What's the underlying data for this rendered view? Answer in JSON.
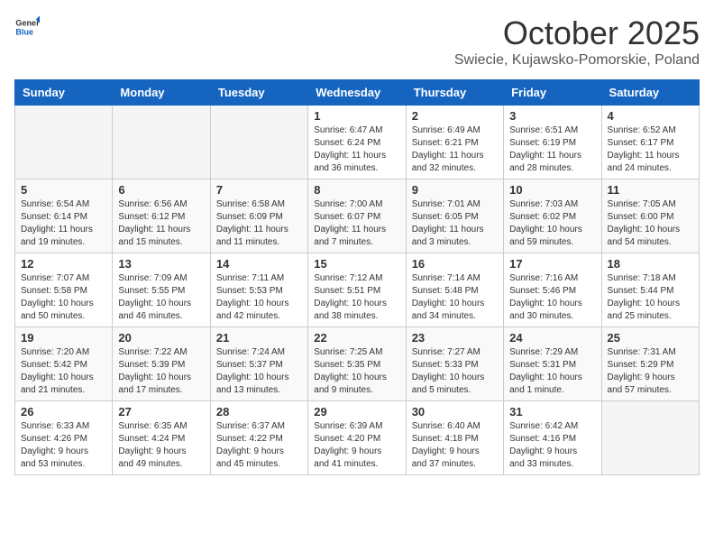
{
  "logo": {
    "general": "General",
    "blue": "Blue"
  },
  "title": "October 2025",
  "subtitle": "Swiecie, Kujawsko-Pomorskie, Poland",
  "days_of_week": [
    "Sunday",
    "Monday",
    "Tuesday",
    "Wednesday",
    "Thursday",
    "Friday",
    "Saturday"
  ],
  "weeks": [
    [
      {
        "day": "",
        "detail": ""
      },
      {
        "day": "",
        "detail": ""
      },
      {
        "day": "",
        "detail": ""
      },
      {
        "day": "1",
        "detail": "Sunrise: 6:47 AM\nSunset: 6:24 PM\nDaylight: 11 hours\nand 36 minutes."
      },
      {
        "day": "2",
        "detail": "Sunrise: 6:49 AM\nSunset: 6:21 PM\nDaylight: 11 hours\nand 32 minutes."
      },
      {
        "day": "3",
        "detail": "Sunrise: 6:51 AM\nSunset: 6:19 PM\nDaylight: 11 hours\nand 28 minutes."
      },
      {
        "day": "4",
        "detail": "Sunrise: 6:52 AM\nSunset: 6:17 PM\nDaylight: 11 hours\nand 24 minutes."
      }
    ],
    [
      {
        "day": "5",
        "detail": "Sunrise: 6:54 AM\nSunset: 6:14 PM\nDaylight: 11 hours\nand 19 minutes."
      },
      {
        "day": "6",
        "detail": "Sunrise: 6:56 AM\nSunset: 6:12 PM\nDaylight: 11 hours\nand 15 minutes."
      },
      {
        "day": "7",
        "detail": "Sunrise: 6:58 AM\nSunset: 6:09 PM\nDaylight: 11 hours\nand 11 minutes."
      },
      {
        "day": "8",
        "detail": "Sunrise: 7:00 AM\nSunset: 6:07 PM\nDaylight: 11 hours\nand 7 minutes."
      },
      {
        "day": "9",
        "detail": "Sunrise: 7:01 AM\nSunset: 6:05 PM\nDaylight: 11 hours\nand 3 minutes."
      },
      {
        "day": "10",
        "detail": "Sunrise: 7:03 AM\nSunset: 6:02 PM\nDaylight: 10 hours\nand 59 minutes."
      },
      {
        "day": "11",
        "detail": "Sunrise: 7:05 AM\nSunset: 6:00 PM\nDaylight: 10 hours\nand 54 minutes."
      }
    ],
    [
      {
        "day": "12",
        "detail": "Sunrise: 7:07 AM\nSunset: 5:58 PM\nDaylight: 10 hours\nand 50 minutes."
      },
      {
        "day": "13",
        "detail": "Sunrise: 7:09 AM\nSunset: 5:55 PM\nDaylight: 10 hours\nand 46 minutes."
      },
      {
        "day": "14",
        "detail": "Sunrise: 7:11 AM\nSunset: 5:53 PM\nDaylight: 10 hours\nand 42 minutes."
      },
      {
        "day": "15",
        "detail": "Sunrise: 7:12 AM\nSunset: 5:51 PM\nDaylight: 10 hours\nand 38 minutes."
      },
      {
        "day": "16",
        "detail": "Sunrise: 7:14 AM\nSunset: 5:48 PM\nDaylight: 10 hours\nand 34 minutes."
      },
      {
        "day": "17",
        "detail": "Sunrise: 7:16 AM\nSunset: 5:46 PM\nDaylight: 10 hours\nand 30 minutes."
      },
      {
        "day": "18",
        "detail": "Sunrise: 7:18 AM\nSunset: 5:44 PM\nDaylight: 10 hours\nand 25 minutes."
      }
    ],
    [
      {
        "day": "19",
        "detail": "Sunrise: 7:20 AM\nSunset: 5:42 PM\nDaylight: 10 hours\nand 21 minutes."
      },
      {
        "day": "20",
        "detail": "Sunrise: 7:22 AM\nSunset: 5:39 PM\nDaylight: 10 hours\nand 17 minutes."
      },
      {
        "day": "21",
        "detail": "Sunrise: 7:24 AM\nSunset: 5:37 PM\nDaylight: 10 hours\nand 13 minutes."
      },
      {
        "day": "22",
        "detail": "Sunrise: 7:25 AM\nSunset: 5:35 PM\nDaylight: 10 hours\nand 9 minutes."
      },
      {
        "day": "23",
        "detail": "Sunrise: 7:27 AM\nSunset: 5:33 PM\nDaylight: 10 hours\nand 5 minutes."
      },
      {
        "day": "24",
        "detail": "Sunrise: 7:29 AM\nSunset: 5:31 PM\nDaylight: 10 hours\nand 1 minute."
      },
      {
        "day": "25",
        "detail": "Sunrise: 7:31 AM\nSunset: 5:29 PM\nDaylight: 9 hours\nand 57 minutes."
      }
    ],
    [
      {
        "day": "26",
        "detail": "Sunrise: 6:33 AM\nSunset: 4:26 PM\nDaylight: 9 hours\nand 53 minutes."
      },
      {
        "day": "27",
        "detail": "Sunrise: 6:35 AM\nSunset: 4:24 PM\nDaylight: 9 hours\nand 49 minutes."
      },
      {
        "day": "28",
        "detail": "Sunrise: 6:37 AM\nSunset: 4:22 PM\nDaylight: 9 hours\nand 45 minutes."
      },
      {
        "day": "29",
        "detail": "Sunrise: 6:39 AM\nSunset: 4:20 PM\nDaylight: 9 hours\nand 41 minutes."
      },
      {
        "day": "30",
        "detail": "Sunrise: 6:40 AM\nSunset: 4:18 PM\nDaylight: 9 hours\nand 37 minutes."
      },
      {
        "day": "31",
        "detail": "Sunrise: 6:42 AM\nSunset: 4:16 PM\nDaylight: 9 hours\nand 33 minutes."
      },
      {
        "day": "",
        "detail": ""
      }
    ]
  ]
}
